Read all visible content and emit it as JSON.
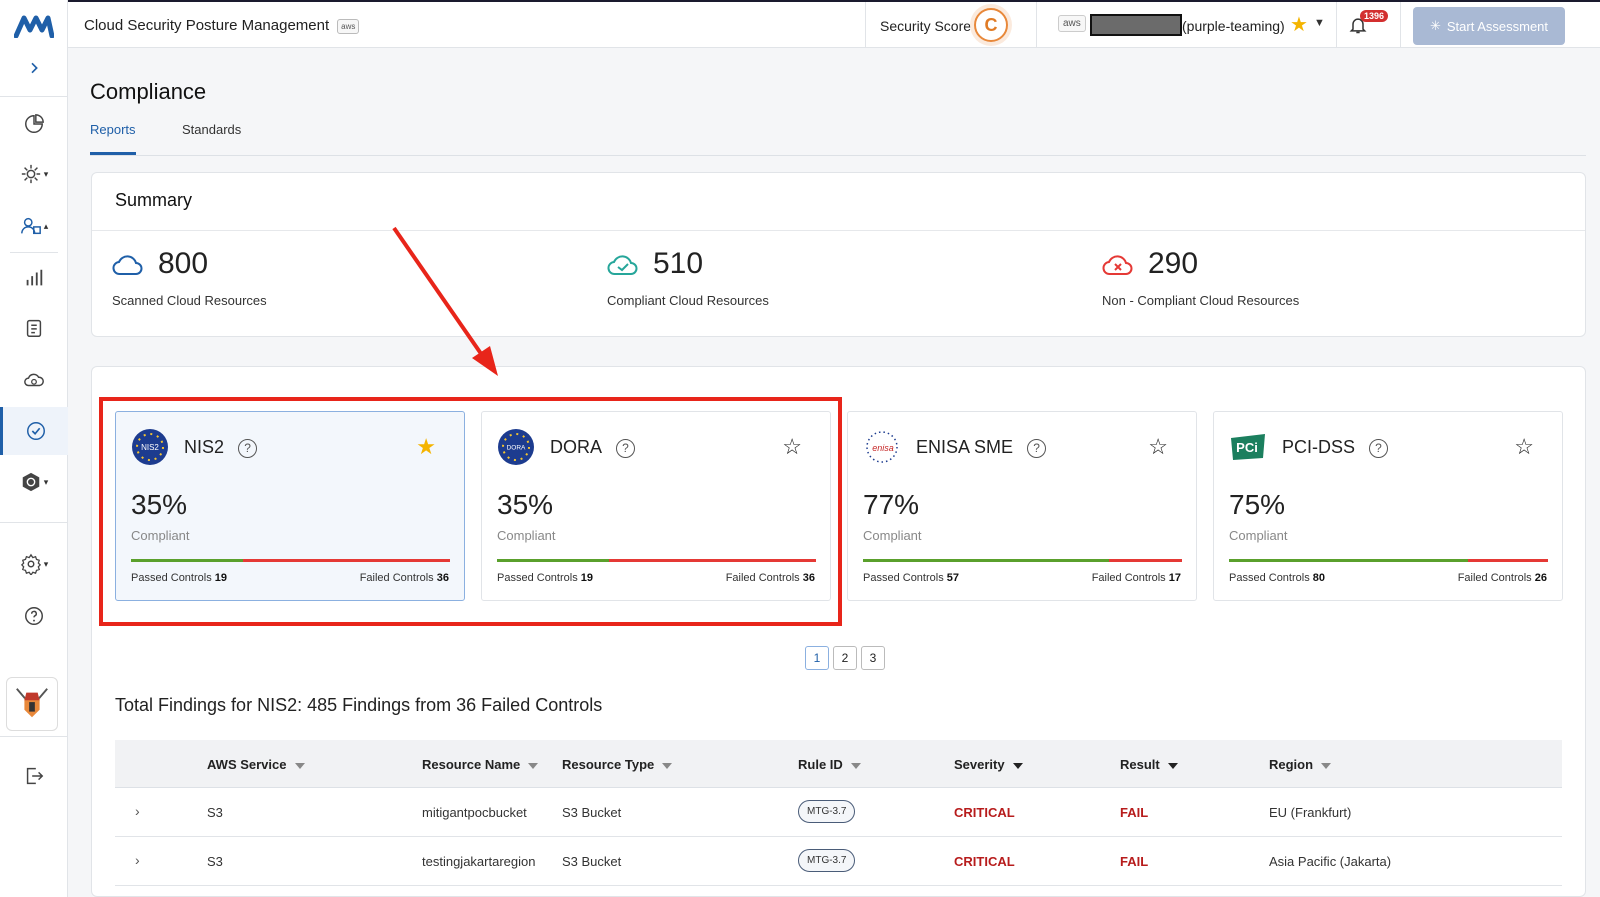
{
  "app": {
    "title": "Cloud Security Posture Management",
    "platform_badge": "aws"
  },
  "topbar": {
    "security_score_label": "Security Score:",
    "security_score_grade": "C",
    "account_badge": "aws",
    "account_name": "(purple-teaming)",
    "notification_count": "1396",
    "start_assessment_label": "Start Assessment"
  },
  "page": {
    "title": "Compliance",
    "tabs": [
      {
        "label": "Reports",
        "active": true
      },
      {
        "label": "Standards",
        "active": false
      }
    ]
  },
  "summary": {
    "title": "Summary",
    "stats": [
      {
        "value": "800",
        "label": "Scanned Cloud Resources"
      },
      {
        "value": "510",
        "label": "Compliant Cloud Resources"
      },
      {
        "value": "290",
        "label": "Non - Compliant Cloud Resources"
      }
    ]
  },
  "standards": [
    {
      "name": "NIS2",
      "logo_text": "NIS2",
      "percent": "35%",
      "compliant_label": "Compliant",
      "passed_label": "Passed Controls",
      "passed": "19",
      "failed_label": "Failed Controls",
      "failed": "36",
      "pass_fraction": 0.35,
      "starred": true,
      "selected": true
    },
    {
      "name": "DORA",
      "logo_text": "DORA",
      "percent": "35%",
      "compliant_label": "Compliant",
      "passed_label": "Passed Controls",
      "passed": "19",
      "failed_label": "Failed Controls",
      "failed": "36",
      "pass_fraction": 0.35,
      "starred": false,
      "selected": false
    },
    {
      "name": "ENISA SME",
      "logo_text": "enisa",
      "percent": "77%",
      "compliant_label": "Compliant",
      "passed_label": "Passed Controls",
      "passed": "57",
      "failed_label": "Failed Controls",
      "failed": "17",
      "pass_fraction": 0.77,
      "starred": false,
      "selected": false
    },
    {
      "name": "PCI-DSS",
      "logo_text": "PCi",
      "percent": "75%",
      "compliant_label": "Compliant",
      "passed_label": "Passed Controls",
      "passed": "80",
      "failed_label": "Failed Controls",
      "failed": "26",
      "pass_fraction": 0.75,
      "starred": false,
      "selected": false
    }
  ],
  "pagination": {
    "pages": [
      "1",
      "2",
      "3"
    ],
    "current": "1"
  },
  "findings": {
    "title": "Total Findings for NIS2: 485 Findings from 36 Failed Controls",
    "columns": [
      "AWS Service",
      "Resource Name",
      "Resource Type",
      "Rule ID",
      "Severity",
      "Result",
      "Region"
    ],
    "rows": [
      {
        "service": "S3",
        "resource_name": "mitigantpocbucket",
        "resource_type": "S3 Bucket",
        "rule_id": "MTG-3.7",
        "severity": "CRITICAL",
        "result": "FAIL",
        "region": "EU (Frankfurt)"
      },
      {
        "service": "S3",
        "resource_name": "testingjakartaregion",
        "resource_type": "S3 Bucket",
        "rule_id": "MTG-3.7",
        "severity": "CRITICAL",
        "result": "FAIL",
        "region": "Asia Pacific (Jakarta)"
      }
    ]
  },
  "colors": {
    "accent": "#1f5fa8",
    "pass": "#5aa02c",
    "fail": "#e53935",
    "critical": "#b71c1c",
    "highlight": "#e8251a"
  }
}
